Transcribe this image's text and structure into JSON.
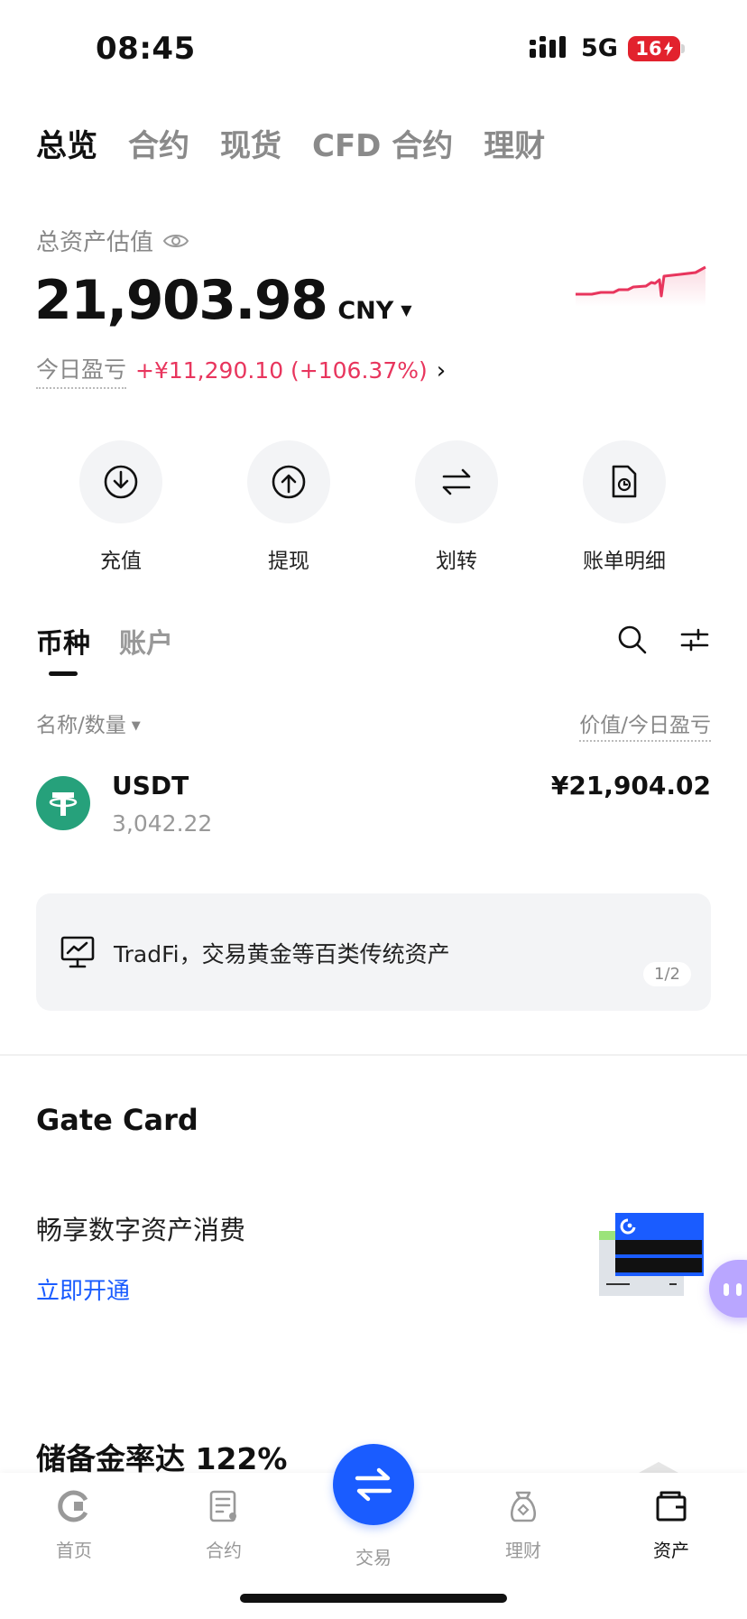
{
  "status_bar": {
    "time": "08:45",
    "network": "5G",
    "battery": "16"
  },
  "top_tabs": [
    "总览",
    "合约",
    "现货",
    "CFD 合约",
    "理财"
  ],
  "summary": {
    "label": "总资产估值",
    "value": "21,903.98",
    "currency": "CNY",
    "pnl_label": "今日盈亏",
    "pnl_value": "+¥11,290.10 (+106.37%)"
  },
  "actions": [
    {
      "label": "充值",
      "icon": "deposit-icon"
    },
    {
      "label": "提现",
      "icon": "withdraw-icon"
    },
    {
      "label": "划转",
      "icon": "transfer-icon"
    },
    {
      "label": "账单明细",
      "icon": "bill-icon"
    }
  ],
  "list": {
    "tabs": [
      "币种",
      "账户"
    ],
    "col_left": "名称/数量",
    "col_right": "价值/今日盈亏",
    "assets": [
      {
        "symbol": "USDT",
        "quantity": "3,042.22",
        "value": "¥21,904.02"
      }
    ]
  },
  "banner": {
    "text": "TradFi，交易黄金等百类传统资产",
    "page": "1/2"
  },
  "gate_card": {
    "title": "Gate Card",
    "description": "畅享数字资产消费",
    "link": "立即开通"
  },
  "reserve": {
    "title": "储备金率达 122%"
  },
  "bottom_nav": [
    {
      "label": "首页",
      "icon": "home-icon"
    },
    {
      "label": "合约",
      "icon": "futures-icon"
    },
    {
      "label": "交易",
      "icon": "trade-icon"
    },
    {
      "label": "理财",
      "icon": "finance-icon"
    },
    {
      "label": "资产",
      "icon": "assets-icon"
    }
  ],
  "colors": {
    "accent": "#1a5cff",
    "profit": "#e8355d",
    "tether": "#26a17b",
    "battery_low": "#e2222d"
  }
}
